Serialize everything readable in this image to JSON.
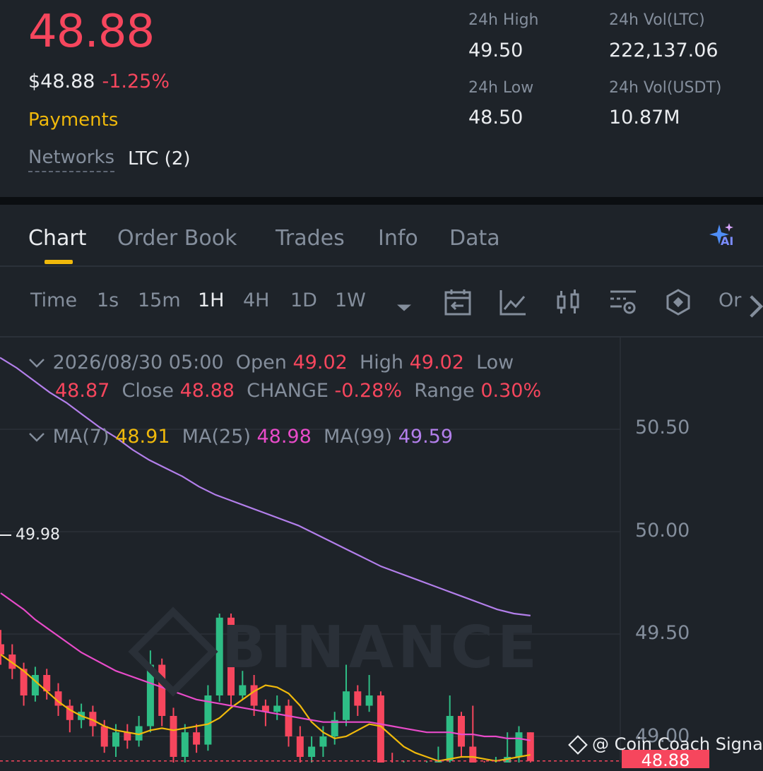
{
  "header": {
    "last_price": "48.88",
    "usd_price": "$48.88",
    "change_pct": "-1.25%",
    "category": "Payments",
    "networks_label": "Networks",
    "networks_value": "LTC (2)",
    "stats": {
      "high_label": "24h High",
      "high_value": "49.50",
      "low_label": "24h Low",
      "low_value": "48.50",
      "vol_ltc_label": "24h Vol(LTC)",
      "vol_ltc_value": "222,137.06",
      "vol_usdt_label": "24h Vol(USDT)",
      "vol_usdt_value": "10.87M"
    }
  },
  "tabs": [
    "Chart",
    "Order Book",
    "Trades",
    "Info",
    "Data"
  ],
  "ai_badge": "AI",
  "toolbar": {
    "time_label": "Time",
    "intervals": [
      "1s",
      "15m",
      "1H",
      "4H",
      "1D",
      "1W"
    ],
    "active_interval": "1H",
    "more_label": "Or"
  },
  "ohlc": {
    "datetime": "2026/08/30 05:00",
    "open_label": "Open",
    "open": "49.02",
    "high_label": "High",
    "high": "49.02",
    "low_label": "Low",
    "low": "48.87",
    "close_label": "Close",
    "close": "48.88",
    "change_label": "CHANGE",
    "change": "-0.28%",
    "range_label": "Range",
    "range": "0.30%"
  },
  "ma": {
    "ma7_label": "MA(7)",
    "ma7": "48.91",
    "ma25_label": "MA(25)",
    "ma25": "48.98",
    "ma99_label": "MA(99)",
    "ma99": "49.59"
  },
  "max_marker": "49.98",
  "current_price_tag": "48.88",
  "watermark": "BINANCE",
  "credit": "@ Coin Coach Signals",
  "colors": {
    "up": "#2ebd85",
    "down": "#f6465d",
    "accent": "#f0b90b",
    "ma7": "#f0b90b",
    "ma25": "#e84bc9",
    "ma99": "#b37feb"
  },
  "chart_data": {
    "type": "candlestick",
    "y_ticks": [
      "50.50",
      "50.00",
      "49.50",
      "49.00"
    ],
    "ylim": [
      48.75,
      50.85
    ],
    "candles": [
      [
        49.45,
        49.4,
        49.52,
        49.35
      ],
      [
        49.4,
        49.33,
        49.45,
        49.28
      ],
      [
        49.33,
        49.2,
        49.36,
        49.15
      ],
      [
        49.2,
        49.3,
        49.34,
        49.17
      ],
      [
        49.3,
        49.22,
        49.33,
        49.18
      ],
      [
        49.22,
        49.15,
        49.26,
        49.1
      ],
      [
        49.15,
        49.08,
        49.18,
        49.02
      ],
      [
        49.08,
        49.12,
        49.16,
        49.04
      ],
      [
        49.12,
        49.05,
        49.15,
        49.0
      ],
      [
        49.05,
        48.95,
        49.08,
        48.92
      ],
      [
        48.95,
        49.02,
        49.06,
        48.9
      ],
      [
        49.02,
        48.98,
        49.06,
        48.94
      ],
      [
        48.98,
        49.05,
        49.1,
        48.95
      ],
      [
        49.05,
        49.35,
        49.42,
        49.02
      ],
      [
        49.35,
        49.1,
        49.38,
        49.05
      ],
      [
        49.1,
        48.9,
        49.14,
        48.85
      ],
      [
        48.9,
        49.02,
        49.06,
        48.86
      ],
      [
        49.02,
        48.96,
        49.06,
        48.92
      ],
      [
        48.96,
        49.2,
        49.25,
        48.93
      ],
      [
        49.2,
        49.58,
        49.6,
        49.17
      ],
      [
        49.58,
        49.2,
        49.6,
        49.15
      ],
      [
        49.2,
        49.25,
        49.32,
        49.18
      ],
      [
        49.25,
        49.15,
        49.3,
        49.1
      ],
      [
        49.15,
        49.12,
        49.18,
        49.05
      ],
      [
        49.12,
        49.15,
        49.2,
        49.08
      ],
      [
        49.15,
        49.0,
        49.18,
        48.95
      ],
      [
        49.0,
        48.9,
        49.05,
        48.85
      ],
      [
        48.9,
        48.95,
        49.0,
        48.86
      ],
      [
        48.95,
        49.0,
        49.05,
        48.9
      ],
      [
        49.0,
        49.08,
        49.12,
        48.96
      ],
      [
        49.08,
        49.22,
        49.35,
        49.05
      ],
      [
        49.22,
        49.15,
        49.25,
        49.1
      ],
      [
        49.15,
        49.2,
        49.3,
        49.12
      ],
      [
        49.2,
        48.85,
        49.22,
        48.82
      ],
      [
        48.85,
        48.78,
        48.92,
        48.75
      ],
      [
        48.78,
        48.82,
        48.88,
        48.74
      ],
      [
        48.82,
        48.8,
        48.86,
        48.76
      ],
      [
        48.8,
        48.85,
        48.88,
        48.77
      ],
      [
        48.85,
        48.88,
        48.95,
        48.82
      ],
      [
        48.88,
        49.1,
        49.2,
        48.84
      ],
      [
        49.1,
        48.95,
        49.12,
        48.9
      ],
      [
        48.95,
        48.82,
        49.15,
        48.78
      ],
      [
        48.82,
        48.8,
        48.88,
        48.76
      ],
      [
        48.8,
        48.84,
        48.9,
        48.77
      ],
      [
        48.84,
        48.9,
        49.02,
        48.8
      ],
      [
        48.9,
        49.02,
        49.05,
        48.86
      ],
      [
        49.02,
        48.88,
        49.02,
        48.87
      ]
    ],
    "ma7": [
      49.4,
      49.36,
      49.32,
      49.27,
      49.22,
      49.17,
      49.13,
      49.1,
      49.08,
      49.05,
      49.03,
      49.02,
      49.01,
      49.03,
      49.04,
      49.03,
      49.04,
      49.05,
      49.06,
      49.09,
      49.14,
      49.18,
      49.22,
      49.25,
      49.24,
      49.21,
      49.15,
      49.07,
      49.02,
      48.99,
      49.0,
      49.03,
      49.06,
      49.05,
      49.0,
      48.95,
      48.92,
      48.9,
      48.88,
      48.89,
      48.9,
      48.9,
      48.89,
      48.88,
      48.89,
      48.9,
      48.91
    ],
    "ma25": [
      49.7,
      49.66,
      49.62,
      49.57,
      49.53,
      49.49,
      49.45,
      49.41,
      49.38,
      49.35,
      49.32,
      49.3,
      49.28,
      49.26,
      49.24,
      49.22,
      49.2,
      49.18,
      49.17,
      49.16,
      49.15,
      49.14,
      49.13,
      49.12,
      49.11,
      49.1,
      49.09,
      49.08,
      49.07,
      49.07,
      49.07,
      49.07,
      49.07,
      49.06,
      49.05,
      49.04,
      49.03,
      49.02,
      49.02,
      49.02,
      49.01,
      49.01,
      49.0,
      49.0,
      48.99,
      48.99,
      48.98
    ],
    "ma99": [
      50.85,
      50.8,
      50.74,
      50.68,
      50.63,
      50.57,
      50.51,
      50.46,
      50.4,
      50.35,
      50.31,
      50.27,
      50.22,
      50.18,
      50.15,
      50.12,
      50.09,
      50.06,
      50.03,
      49.99,
      49.95,
      49.91,
      49.87,
      49.83,
      49.8,
      49.77,
      49.74,
      49.71,
      49.68,
      49.65,
      49.62,
      49.6,
      49.59
    ],
    "ma99_start_index": 0
  }
}
